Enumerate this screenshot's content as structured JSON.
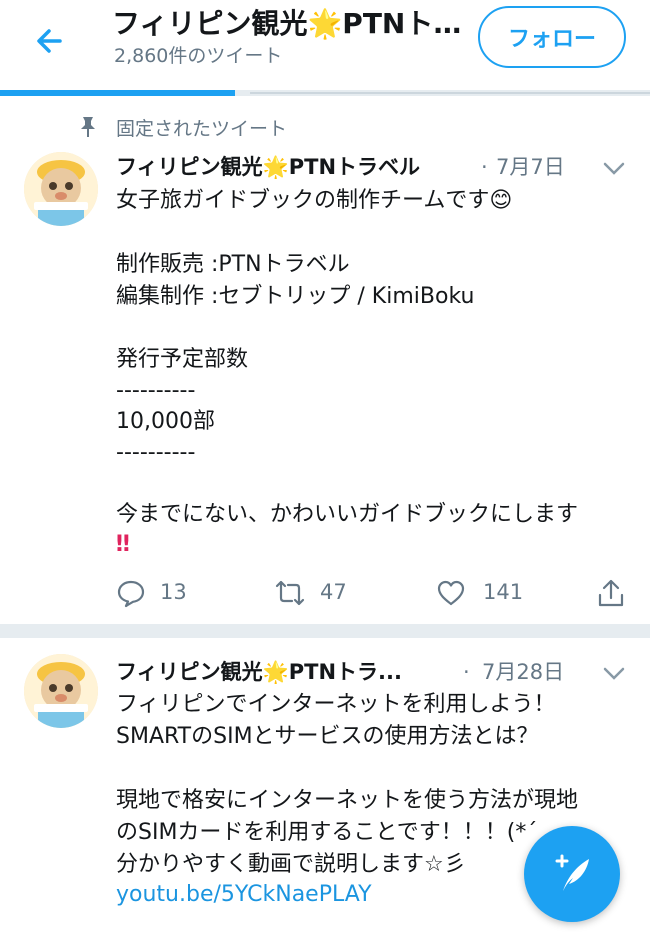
{
  "header": {
    "title": "フィリピン観光🌟PTNトラベル",
    "tweet_count": "2,860件のツイート",
    "follow_label": "フォロー"
  },
  "colors": {
    "accent": "#1da1f2",
    "link": "#1b95e0",
    "secondary_text": "#657786",
    "heart": "#e0245e"
  },
  "icons": [
    "back-arrow-icon",
    "pin-icon",
    "chevron-down-icon",
    "reply-icon",
    "retweet-icon",
    "like-icon",
    "share-icon",
    "compose-tweet-icon"
  ],
  "pinned_tweet": {
    "pinned_label": "固定されたツイート",
    "author": "フィリピン観光🌟PTNトラベル",
    "date": "7月7日",
    "dot": "·",
    "lines": [
      "女子旅ガイドブックの制作チームです😊",
      "制作販売 :PTNトラベル",
      "編集制作 :セブトリップ / KimiBoku",
      "発行予定部数",
      "----------",
      "10,000部",
      "----------",
      "今までにない、かわいいガイドブックにします",
      "‼"
    ],
    "replies": "13",
    "retweets": "47",
    "likes": "141"
  },
  "second_tweet": {
    "author": "フィリピン観光🌟PTNトラ...",
    "dot": "·",
    "date": "7月28日",
    "lines": [
      "フィリピンでインターネットを利用しよう！",
      "SMARTのSIMとサービスの使用方法とは？",
      "現地で格安にインターネットを使う方法が現地",
      "のSIMカードを利用することです！！！(*´",
      "分かりやすく動画で説明します☆彡"
    ],
    "link": "youtu.be/5YCkNaePLAY"
  }
}
